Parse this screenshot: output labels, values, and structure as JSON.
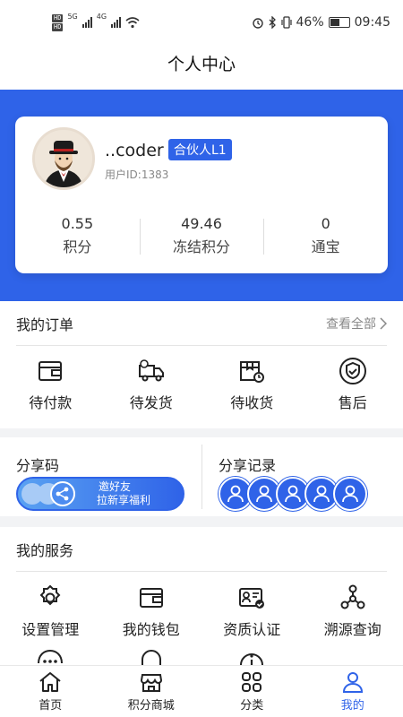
{
  "status_bar": {
    "left_icons": [
      "hd-icon",
      "5g-signal-icon",
      "4g-signal-icon",
      "wifi-icon"
    ],
    "battery": "46%",
    "time": "09:45",
    "net1": "5G",
    "net2": "4G"
  },
  "header": {
    "title": "个人中心"
  },
  "profile": {
    "name": "..coder",
    "badge": "合伙人L1",
    "user_id": "用户ID:1383",
    "stats": [
      {
        "value": "0.55",
        "label": "积分"
      },
      {
        "value": "49.46",
        "label": "冻结积分"
      },
      {
        "value": "0",
        "label": "通宝"
      }
    ]
  },
  "orders": {
    "title": "我的订单",
    "view_all": "查看全部",
    "items": [
      {
        "label": "待付款",
        "icon": "wallet-icon"
      },
      {
        "label": "待发货",
        "icon": "delivery-truck-icon"
      },
      {
        "label": "待收货",
        "icon": "package-clock-icon"
      },
      {
        "label": "售后",
        "icon": "shield-check-icon"
      }
    ]
  },
  "share": {
    "code_title": "分享码",
    "banner_line1": "邀好友",
    "banner_line2": "拉新享福利",
    "record_title": "分享记录",
    "record_avatar_count": 5
  },
  "services": {
    "title": "我的服务",
    "items": [
      {
        "label": "设置管理",
        "icon": "gear-icon"
      },
      {
        "label": "我的钱包",
        "icon": "wallet-icon"
      },
      {
        "label": "资质认证",
        "icon": "id-card-icon"
      },
      {
        "label": "溯源查询",
        "icon": "trace-nodes-icon"
      }
    ]
  },
  "tabs": [
    {
      "label": "首页",
      "icon": "home-icon"
    },
    {
      "label": "积分商城",
      "icon": "store-icon"
    },
    {
      "label": "分类",
      "icon": "grid-icon"
    },
    {
      "label": "我的",
      "icon": "user-icon",
      "active": true
    }
  ],
  "colors": {
    "accent": "#2f63e8",
    "background": "#f2f3f5"
  }
}
